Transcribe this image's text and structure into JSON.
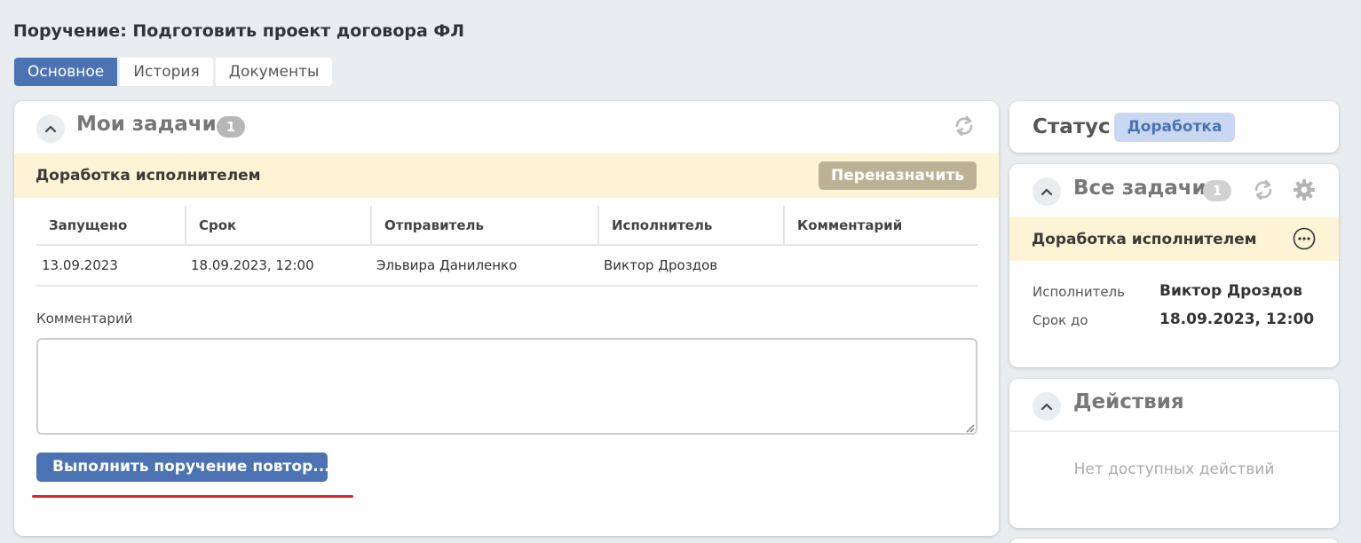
{
  "page": {
    "title": "Поручение: Подготовить проект договора ФЛ"
  },
  "tabs": [
    {
      "label": "Основное",
      "active": true
    },
    {
      "label": "История",
      "active": false
    },
    {
      "label": "Документы",
      "active": false
    }
  ],
  "my_tasks": {
    "title": "Мои задачи",
    "count": "1",
    "refresh_icon": "refresh-icon",
    "stage": "Доработка исполнителем",
    "reassign_label": "Переназначить",
    "columns": [
      "Запущено",
      "Срок",
      "Отправитель",
      "Исполнитель",
      "Комментарий"
    ],
    "rows": [
      [
        "13.09.2023",
        "18.09.2023, 12:00",
        "Эльвира Даниленко",
        "Виктор Дроздов",
        ""
      ]
    ],
    "comment_label": "Комментарий",
    "comment_value": "",
    "execute_label": "Выполнить поручение повтор..."
  },
  "status": {
    "label": "Статус",
    "value": "Доработка"
  },
  "all_tasks": {
    "title": "Все задачи",
    "count": "1",
    "stage": "Доработка исполнителем",
    "executor_label": "Исполнитель",
    "executor_value": "Виктор Дроздов",
    "deadline_label": "Срок до",
    "deadline_value": "18.09.2023, 12:00"
  },
  "actions": {
    "title": "Действия",
    "empty_text": "Нет доступных действий"
  },
  "colors": {
    "accent": "#4b73b4",
    "stage_bg": "#fdf3d5",
    "reassign_bg": "#bbb296",
    "status_badge_bg": "#c9d8f0",
    "highlight_line": "#e0232a"
  }
}
